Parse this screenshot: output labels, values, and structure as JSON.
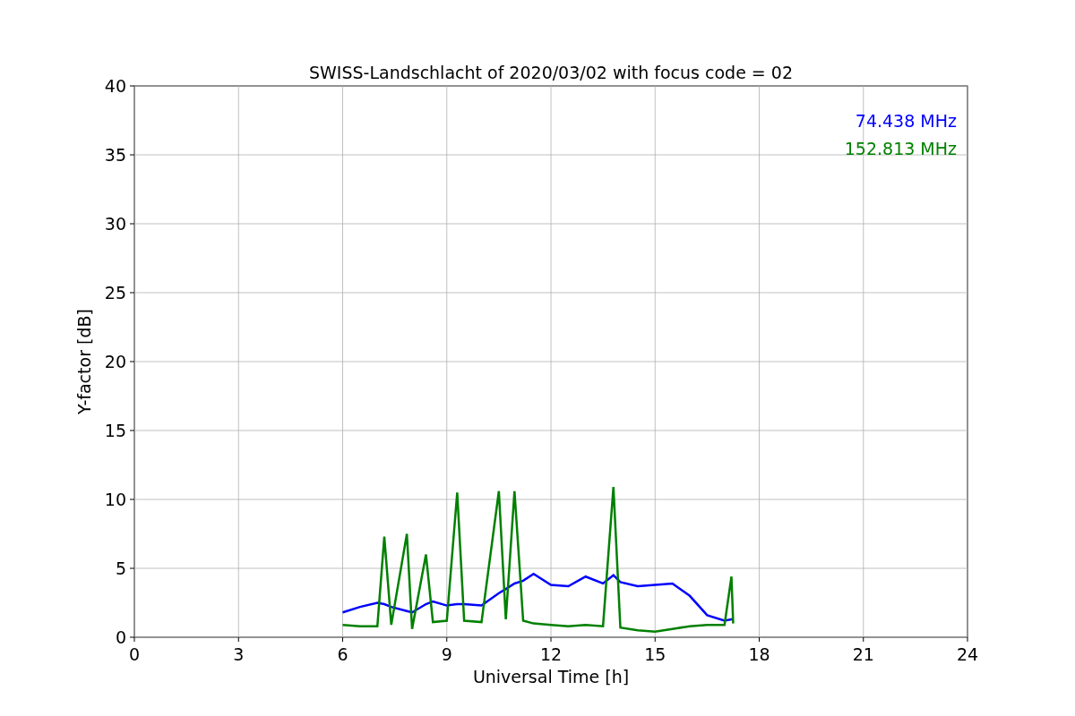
{
  "chart_data": {
    "type": "line",
    "title": "SWISS-Landschlacht of 2020/03/02 with focus code = 02",
    "xlabel": "Universal Time [h]",
    "ylabel": "Y-factor [dB]",
    "x": [
      6,
      6.5,
      7,
      7.2,
      7.4,
      7.85,
      8,
      8.4,
      8.6,
      9,
      9.3,
      9.5,
      10,
      10.5,
      10.7,
      10.95,
      11.2,
      11.5,
      12,
      12.5,
      13,
      13.5,
      13.8,
      14,
      14.5,
      15,
      15.5,
      16,
      16.5,
      17,
      17.2,
      17.25
    ],
    "series": [
      {
        "name": "74.438 MHz",
        "color": "#0000ff",
        "values": [
          1.8,
          2.2,
          2.5,
          2.4,
          2.2,
          1.9,
          1.8,
          2.4,
          2.6,
          2.3,
          2.4,
          2.4,
          2.3,
          3.2,
          3.5,
          3.9,
          4.1,
          4.6,
          3.8,
          3.7,
          4.4,
          3.9,
          4.5,
          4.0,
          3.7,
          3.8,
          3.9,
          3.0,
          1.6,
          1.2,
          1.3,
          1.3
        ]
      },
      {
        "name": "152.813 MHz",
        "color": "#008000",
        "values": [
          0.9,
          0.8,
          0.8,
          7.3,
          0.9,
          7.5,
          0.6,
          6.0,
          1.1,
          1.2,
          10.5,
          1.2,
          1.1,
          10.6,
          1.3,
          10.6,
          1.2,
          1.0,
          0.9,
          0.8,
          0.9,
          0.8,
          10.9,
          0.7,
          0.5,
          0.4,
          0.6,
          0.8,
          0.9,
          0.9,
          4.4,
          1.0
        ]
      }
    ],
    "grid": true,
    "xlim": [
      0,
      24
    ],
    "ylim": [
      0,
      40
    ],
    "xticks": [
      0,
      3,
      6,
      9,
      12,
      15,
      18,
      21,
      24
    ],
    "yticks": [
      0,
      5,
      10,
      15,
      20,
      25,
      30,
      35,
      40
    ]
  }
}
